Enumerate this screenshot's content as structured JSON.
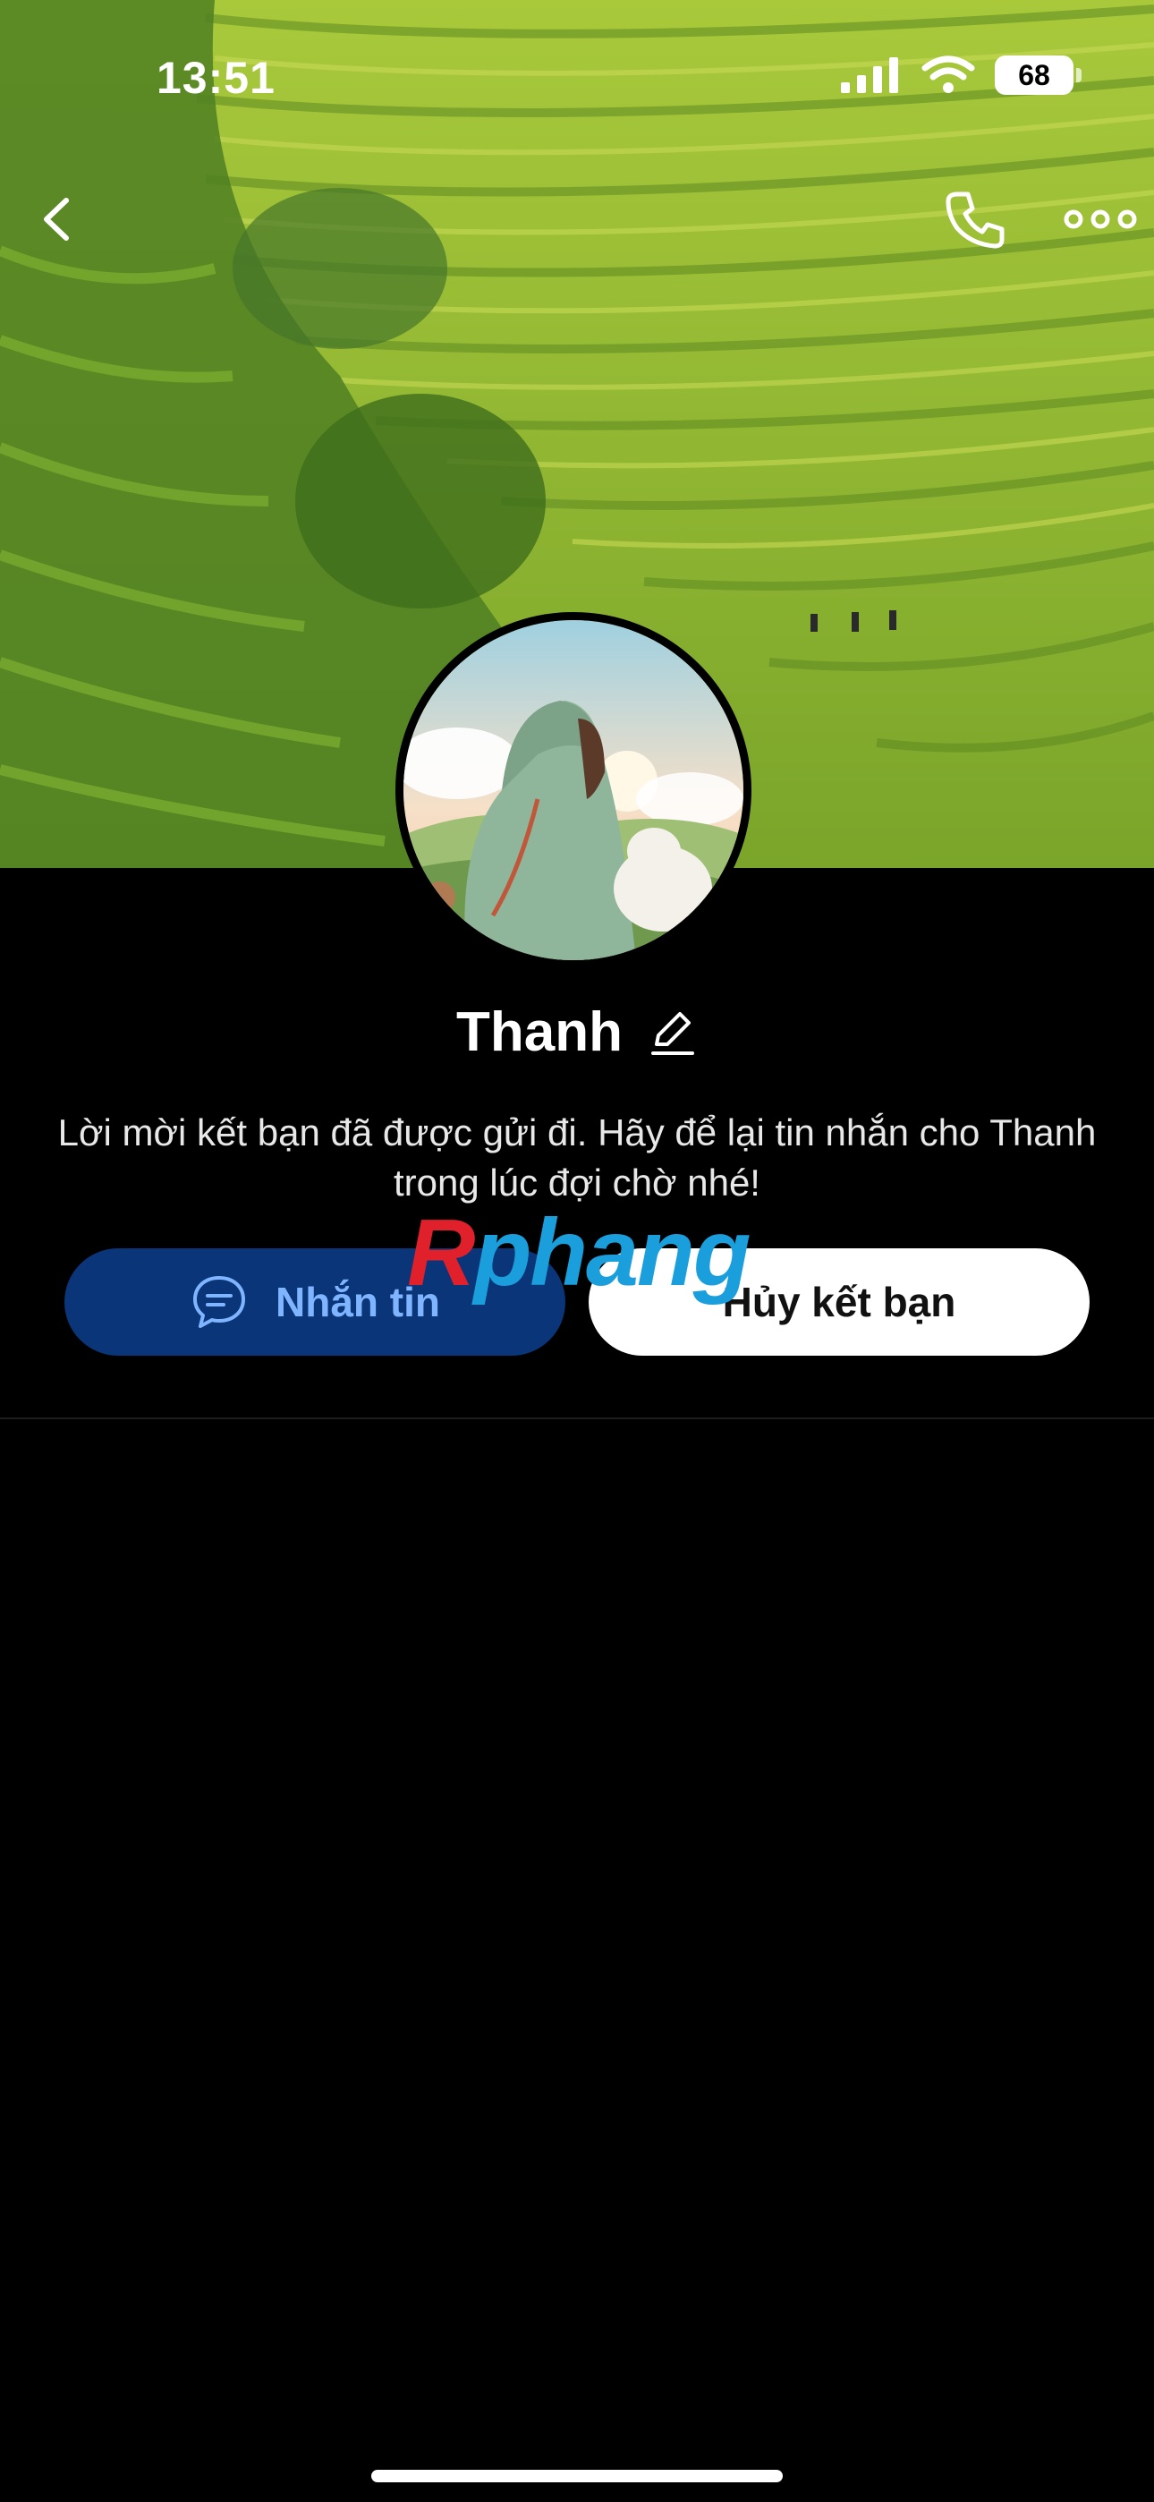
{
  "status_bar": {
    "time": "13:51",
    "battery": "68"
  },
  "profile": {
    "name": "Thanh",
    "message": "Lời mời kết bạn đã được gửi đi. Hãy để lại tin nhắn cho Thanh trong lúc đợi chờ nhé!"
  },
  "actions": {
    "message_label": "Nhắn tin",
    "unfriend_label": "Hủy kết bạn"
  },
  "watermark": {
    "text_r": "R",
    "text_rest": "phang"
  },
  "icons": {
    "back": "chevron-left-icon",
    "call": "phone-icon",
    "more": "more-horizontal-icon",
    "edit": "pencil-icon",
    "chat": "chat-bubble-icon"
  },
  "colors": {
    "message_button_bg": "#0a3578",
    "message_button_text": "#7fb4ff",
    "unfriend_button_bg": "#ffffff"
  }
}
